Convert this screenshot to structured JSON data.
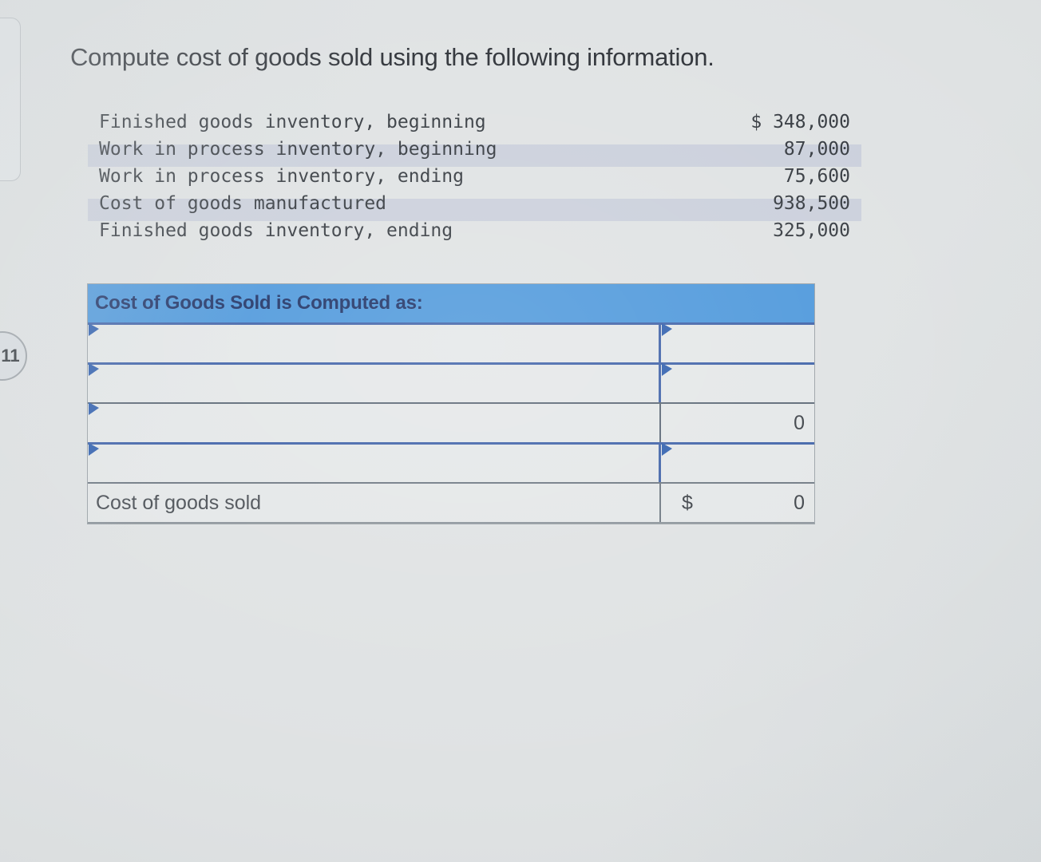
{
  "prompt": {
    "title": "Compute cost of goods sold using the following information."
  },
  "left_chrome": {
    "question_number": "11"
  },
  "given_data": {
    "rows": [
      {
        "label": "Finished goods inventory, beginning",
        "value": "$ 348,000",
        "banded": false
      },
      {
        "label": "Work in process inventory, beginning",
        "value": "87,000",
        "banded": true
      },
      {
        "label": "Work in process inventory, ending",
        "value": "75,600",
        "banded": false
      },
      {
        "label": "Cost of goods manufactured",
        "value": "938,500",
        "banded": true
      },
      {
        "label": "Finished goods inventory, ending",
        "value": "325,000",
        "banded": false
      }
    ]
  },
  "answer_table": {
    "header": "Cost of Goods Sold is Computed as:",
    "entry_rows": [
      {
        "label": "",
        "value": "",
        "label_marker": true,
        "value_marker": true
      },
      {
        "label": "",
        "value": "",
        "label_marker": true,
        "value_marker": true
      },
      {
        "label": "",
        "value": "0",
        "label_marker": true,
        "value_marker": false
      },
      {
        "label": "",
        "value": "",
        "label_marker": true,
        "value_marker": true
      }
    ],
    "total": {
      "label": "Cost of goods sold",
      "currency": "$",
      "value": "0"
    }
  },
  "colors": {
    "page_background": "#dfe2e3",
    "header_blue": "#4c97db",
    "header_text": "#1b2f63",
    "grid_blue": "#3f62a8",
    "band_gray": "#c4c9d8",
    "cell_background": "#e4e7e8"
  }
}
